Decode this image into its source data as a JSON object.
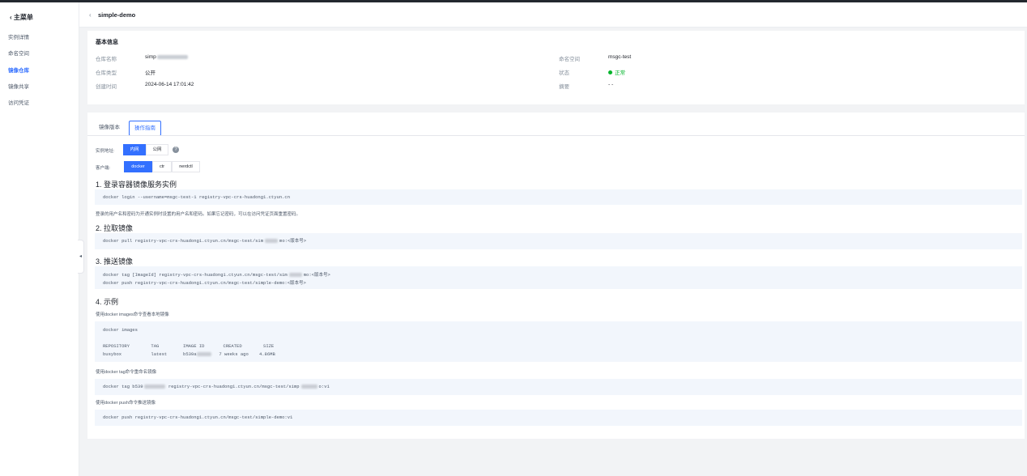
{
  "sidebar": {
    "title": "主菜单",
    "items": [
      {
        "label": "实例详情",
        "active": false
      },
      {
        "label": "命名空间",
        "active": false
      },
      {
        "label": "镜像仓库",
        "active": true
      },
      {
        "label": "镜像共享",
        "active": false
      },
      {
        "label": "访问凭证",
        "active": false
      }
    ]
  },
  "header": {
    "title": "simple-demo"
  },
  "basic": {
    "title": "基本信息",
    "repo_name_label": "仓库名称",
    "repo_name_value": "simp",
    "repo_type_label": "仓库类型",
    "repo_type_value": "公开",
    "created_label": "创建时间",
    "created_value": "2024-06-14 17:01:42",
    "namespace_label": "命名空间",
    "namespace_value": "msgc-test",
    "status_label": "状态",
    "status_value": "正常",
    "summary_label": "摘要",
    "summary_value": "- -"
  },
  "guide": {
    "tabs": [
      "镜像版本",
      "操作指南"
    ],
    "active_tab": "操作指南",
    "address_label": "实例地址:",
    "address_options": [
      "内网",
      "公网"
    ],
    "address_selected": "内网",
    "client_label": "客户端:",
    "client_options": [
      "docker",
      "ctr",
      "nerdctl"
    ],
    "client_selected": "docker",
    "step1_title": "1. 登录容器镜像服务实例",
    "step1_code": "docker login --username=msgc-test-1 registry-vpc-crs-huadong1.ctyun.cn",
    "step1_note": "登录的用户名和密码为开通实例时设置的用户名和密码。如果忘记密码，可以在访问凭证页面重置密码。",
    "step2_title": "2. 拉取镜像",
    "step2_code_a": "docker pull registry-vpc-crs-huadong1.ctyun.cn/msgc-test/sim",
    "step2_code_b": "mo:<版本号>",
    "step3_title": "3. 推送镜像",
    "step3_line1_a": "docker tag [ImageId] registry-vpc-crs-huadong1.ctyun.cn/msgc-test/sim",
    "step3_line1_b": "mo:<版本号>",
    "step3_line2": "docker push registry-vpc-crs-huadong1.ctyun.cn/msgc-test/simple-demo:<版本号>",
    "step4_title": "4. 示例",
    "ex1_note": "使用docker images命令查看本地镜像",
    "ex1_cmd": "docker images",
    "ex1_header": "REPOSITORY        TAG         IMAGE ID       CREATED        SIZE",
    "ex1_row_a": "busybox           latest      b539a",
    "ex1_row_b": "   7 weeks ago    4.86MB",
    "ex2_note": "使用docker tag命令重命名镜像",
    "ex2_code_a": "docker tag b539",
    "ex2_code_b": " registry-vpc-crs-huadong1.ctyun.cn/msgc-test/simp",
    "ex2_code_c": "o:v1",
    "ex3_note": "使用docker push命令推送镜像",
    "ex3_code": "docker push registry-vpc-crs-huadong1.ctyun.cn/msgc-test/simple-demo:v1"
  }
}
